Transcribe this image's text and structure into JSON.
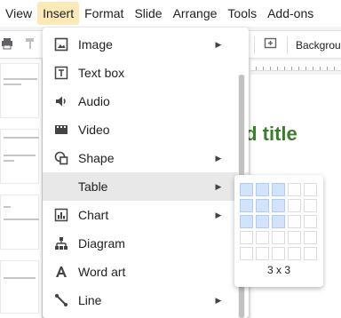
{
  "menubar": {
    "items": [
      {
        "label": "View",
        "active": false
      },
      {
        "label": "Insert",
        "active": true
      },
      {
        "label": "Format",
        "active": false
      },
      {
        "label": "Slide",
        "active": false
      },
      {
        "label": "Arrange",
        "active": false
      },
      {
        "label": "Tools",
        "active": false
      },
      {
        "label": "Add-ons",
        "active": false
      }
    ]
  },
  "toolbar": {
    "background_label": "Background"
  },
  "canvas": {
    "title_fragment": "ld title"
  },
  "insert_menu": {
    "items": [
      {
        "label": "Image",
        "icon": "image-icon",
        "submenu": true
      },
      {
        "label": "Text box",
        "icon": "text-box-icon",
        "submenu": false
      },
      {
        "label": "Audio",
        "icon": "audio-icon",
        "submenu": false
      },
      {
        "label": "Video",
        "icon": "video-icon",
        "submenu": false
      },
      {
        "label": "Shape",
        "icon": "shape-icon",
        "submenu": true
      },
      {
        "label": "Table",
        "icon": "",
        "submenu": true,
        "highlighted": true
      },
      {
        "label": "Chart",
        "icon": "chart-icon",
        "submenu": true
      },
      {
        "label": "Diagram",
        "icon": "diagram-icon",
        "submenu": false
      },
      {
        "label": "Word art",
        "icon": "word-art-icon",
        "submenu": false
      },
      {
        "label": "Line",
        "icon": "line-icon",
        "submenu": true
      }
    ]
  },
  "table_grid": {
    "selected_cols": 3,
    "selected_rows": 3,
    "size_label": "3 x 3"
  },
  "colors": {
    "menu_active_bg": "#fbe9b7",
    "hover_bg": "#e8e8e8",
    "grid_selected": "#d2e3fc",
    "title_green": "#3a7d2c"
  }
}
